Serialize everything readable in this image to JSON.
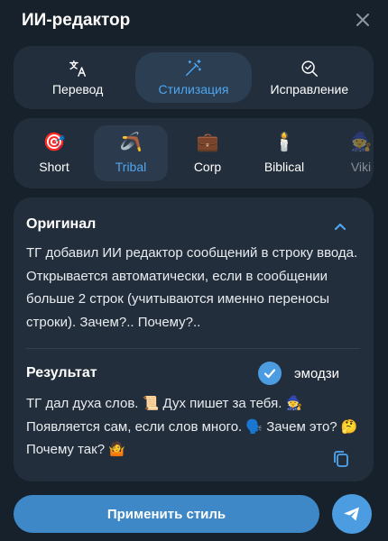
{
  "header": {
    "title": "ИИ-редактор",
    "close_icon": "close-icon"
  },
  "mode_tabs": [
    {
      "label": "Перевод",
      "icon": "translate-icon",
      "active": false
    },
    {
      "label": "Стилизация",
      "icon": "magic-wand-icon",
      "active": true
    },
    {
      "label": "Исправление",
      "icon": "proofread-icon",
      "active": false
    }
  ],
  "styles": [
    {
      "label": "Short",
      "emoji": "🎯",
      "active": false
    },
    {
      "label": "Tribal",
      "emoji": "🪃",
      "active": true
    },
    {
      "label": "Corp",
      "emoji": "💼",
      "active": false
    },
    {
      "label": "Biblical",
      "emoji": "🕯️",
      "active": false
    },
    {
      "label": "Viki",
      "emoji": "🧙",
      "active": false
    }
  ],
  "original": {
    "title": "Оригинал",
    "text": "ТГ добавил ИИ редактор сообщений в строку ввода. Открывается автоматически, если в сообщении больше 2 строк (учитываются именно переносы строки). Зачем?.. Почему?.."
  },
  "result": {
    "title": "Результат",
    "emoji_toggle_label": "эмодзи",
    "emoji_enabled": true,
    "text": "ТГ дал духа слов. 📜 Дух пишет за тебя. 🧙 Появляется сам, если слов много. 🗣️ Зачем это? 🤔 Почему так? 🤷"
  },
  "footer": {
    "apply_label": "Применить стиль",
    "send_icon": "send-icon"
  },
  "colors": {
    "accent": "#4fa6f0",
    "background": "#17212b",
    "panel": "#232e3c",
    "button": "#3e88c8"
  }
}
